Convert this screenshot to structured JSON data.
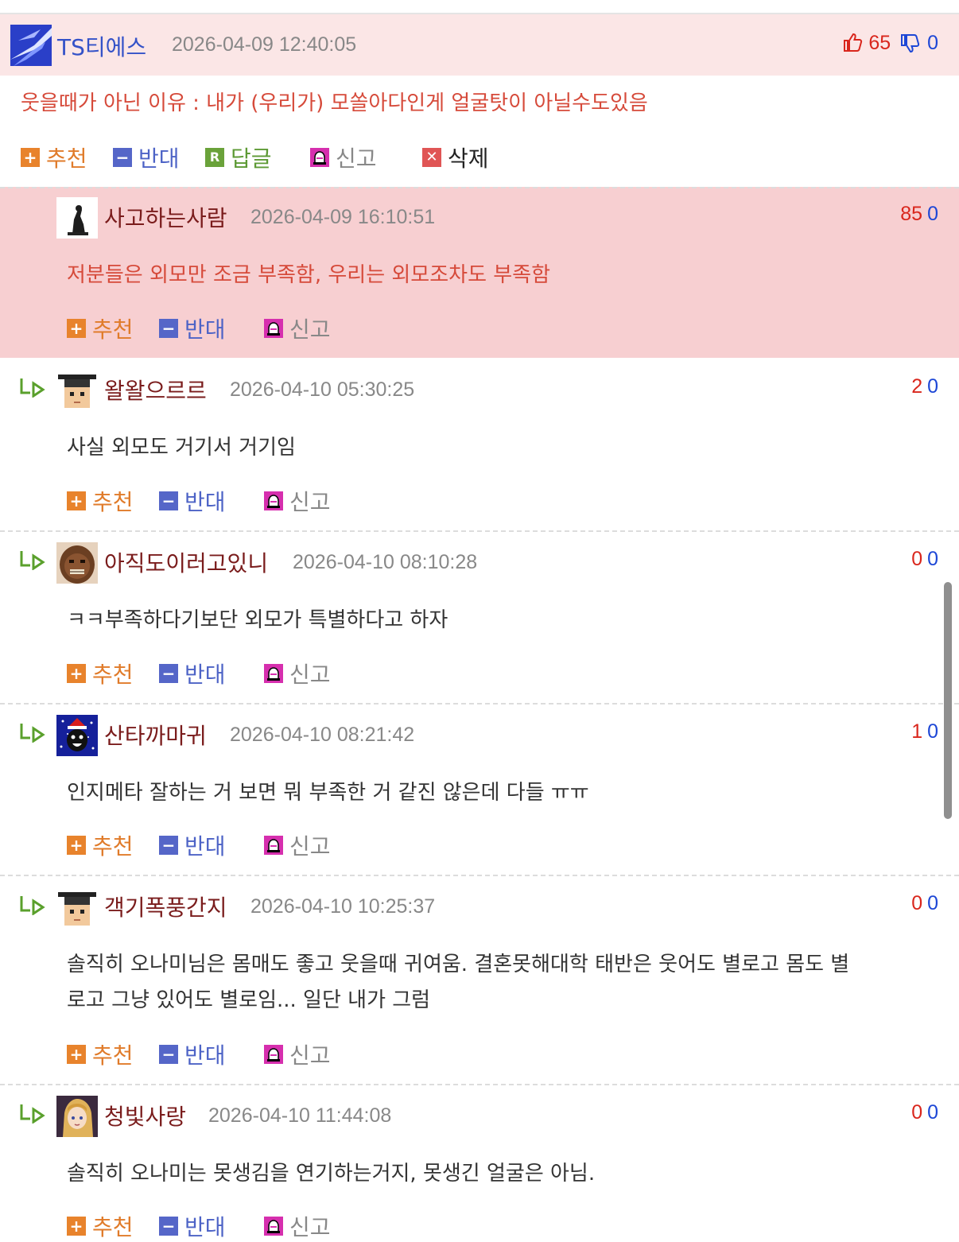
{
  "main_comment": {
    "nickname": "TS티에스",
    "date": "2026-04-09 12:40:05",
    "likes": "65",
    "dislikes": "0",
    "text": "웃을때가 아닌 이유 : 내가 (우리가) 모쏠아다인게 얼굴탓이 아닐수도있음",
    "actions": {
      "up": "추천",
      "down": "반대",
      "reply": "답글",
      "report": "신고",
      "delete": "삭제"
    },
    "icons": [
      "thumbs-up-icon",
      "thumbs-down-icon"
    ]
  },
  "replies": [
    {
      "nickname": "사고하는사람",
      "date": "2026-04-09 16:10:51",
      "likes": "85",
      "dislikes": "0",
      "lines": [
        "저분들은 외모만 조금 부족함, 우리는 외모조차도 부족함"
      ]
    },
    {
      "nickname": "왈왈으르르",
      "date": "2026-04-10 05:30:25",
      "likes": "2",
      "dislikes": "0",
      "lines": [
        "사실 외모도 거기서 거기임"
      ]
    },
    {
      "nickname": "아직도이러고있니",
      "date": "2026-04-10 08:10:28",
      "likes": "0",
      "dislikes": "0",
      "lines": [
        "ㅋㅋ부족하다기보단 외모가 특별하다고 하자"
      ]
    },
    {
      "nickname": "산타까마귀",
      "date": "2026-04-10 08:21:42",
      "likes": "1",
      "dislikes": "0",
      "lines": [
        "인지메타 잘하는 거 보면 뭐 부족한 거 같진 않은데 다들 ㅠㅠ"
      ]
    },
    {
      "nickname": "객기폭풍간지",
      "date": "2026-04-10 10:25:37",
      "likes": "0",
      "dislikes": "0",
      "lines": [
        "솔직히 오나미님은 몸매도 좋고 웃을때 귀여움. 결혼못해대학 태반은 웃어도 별로고 몸도 별",
        "로고 그냥 있어도 별로임... 일단 내가 그럼"
      ]
    },
    {
      "nickname": "청빛사랑",
      "date": "2026-04-10 11:44:08",
      "likes": "0",
      "dislikes": "0",
      "lines": [
        "솔직히 오나미는 못생김을 연기하는거지, 못생긴 얼굴은 아님."
      ]
    }
  ],
  "reply_actions": {
    "up": "추천",
    "down": "반대",
    "report": "신고"
  }
}
